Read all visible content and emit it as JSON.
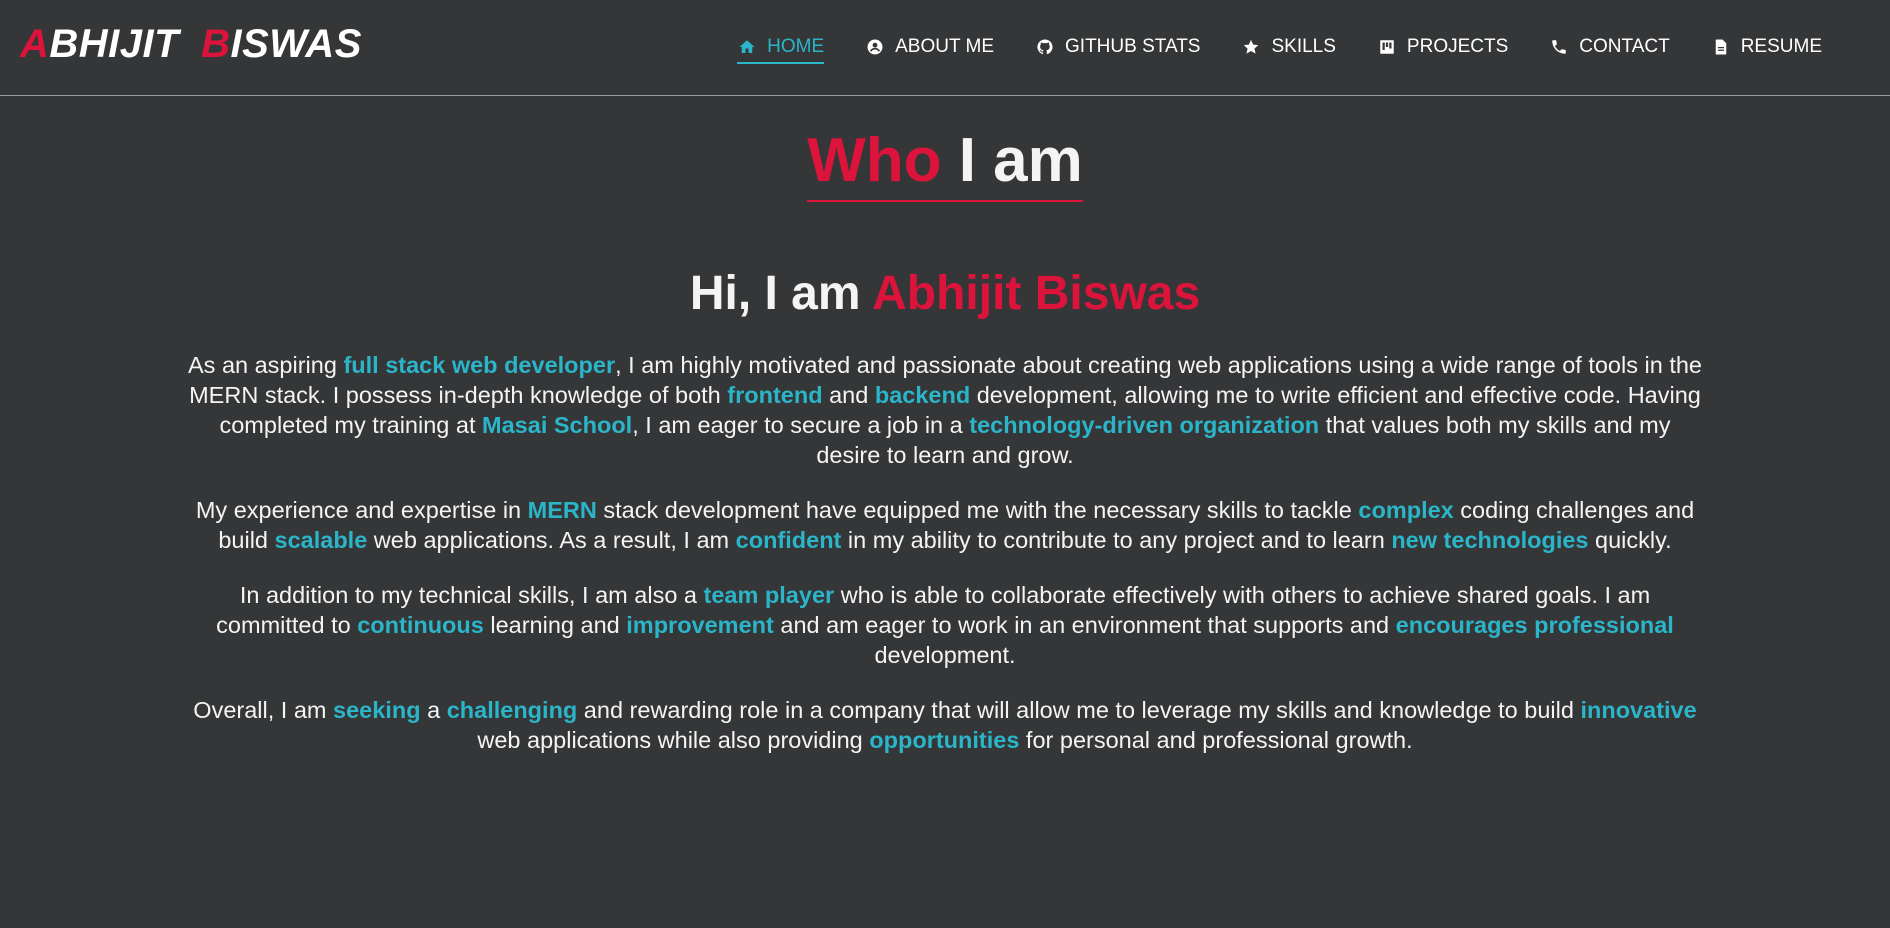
{
  "brand": {
    "first_initial": "A",
    "first_rest": "BHIJIT",
    "last_initial": "B",
    "last_rest": "ISWAS",
    "accent_color": "#dc143c"
  },
  "nav": {
    "items": [
      {
        "label": "HOME",
        "icon": "home-icon",
        "active": true
      },
      {
        "label": "ABOUT ME",
        "icon": "user-circle-icon",
        "active": false
      },
      {
        "label": "GITHUB STATS",
        "icon": "github-icon",
        "active": false
      },
      {
        "label": "SKILLS",
        "icon": "star-icon",
        "active": false
      },
      {
        "label": "PROJECTS",
        "icon": "board-icon",
        "active": false
      },
      {
        "label": "CONTACT",
        "icon": "phone-icon",
        "active": false
      },
      {
        "label": "RESUME",
        "icon": "document-icon",
        "active": false
      }
    ],
    "active_color": "#2bb5c9"
  },
  "section": {
    "title_red": "Who",
    "title_white": "I am"
  },
  "intro": {
    "greeting": "Hi, I am",
    "name": "Abhijit Biswas"
  },
  "about": {
    "highlight_color": "#2bb5c9",
    "paragraphs": [
      [
        {
          "t": "As an aspiring "
        },
        {
          "t": "full stack web developer",
          "hl": true
        },
        {
          "t": ", I am highly motivated and passionate about creating web applications using a wide range of tools in the MERN stack. I possess in-depth knowledge of both "
        },
        {
          "t": "frontend",
          "hl": true
        },
        {
          "t": " and "
        },
        {
          "t": "backend",
          "hl": true
        },
        {
          "t": " development, allowing me to write efficient and effective code. Having completed my training at "
        },
        {
          "t": "Masai School",
          "hl": true
        },
        {
          "t": ", I am eager to secure a job in a "
        },
        {
          "t": "technology-driven organization",
          "hl": true
        },
        {
          "t": " that values both my skills and my desire to learn and grow."
        }
      ],
      [
        {
          "t": "My experience and expertise in "
        },
        {
          "t": "MERN",
          "hl": true
        },
        {
          "t": " stack development have equipped me with the necessary skills to tackle "
        },
        {
          "t": "complex",
          "hl": true
        },
        {
          "t": " coding challenges and build "
        },
        {
          "t": "scalable",
          "hl": true
        },
        {
          "t": " web applications. As a result, I am "
        },
        {
          "t": "confident",
          "hl": true
        },
        {
          "t": " in my ability to contribute to any project and to learn "
        },
        {
          "t": "new technologies",
          "hl": true
        },
        {
          "t": " quickly."
        }
      ],
      [
        {
          "t": "In addition to my technical skills, I am also a "
        },
        {
          "t": "team player",
          "hl": true
        },
        {
          "t": " who is able to collaborate effectively with others to achieve shared goals. I am committed to "
        },
        {
          "t": "continuous",
          "hl": true
        },
        {
          "t": " learning and "
        },
        {
          "t": "improvement",
          "hl": true
        },
        {
          "t": " and am eager to work in an environment that supports and "
        },
        {
          "t": "encourages professional",
          "hl": true
        },
        {
          "t": " development."
        }
      ],
      [
        {
          "t": "Overall, I am "
        },
        {
          "t": "seeking",
          "hl": true
        },
        {
          "t": " a "
        },
        {
          "t": "challenging",
          "hl": true
        },
        {
          "t": " and rewarding role in a company that will allow me to leverage my skills and knowledge to build "
        },
        {
          "t": "innovative",
          "hl": true
        },
        {
          "t": " web applications while also providing "
        },
        {
          "t": "opportunities",
          "hl": true
        },
        {
          "t": " for personal and professional growth."
        }
      ]
    ]
  }
}
